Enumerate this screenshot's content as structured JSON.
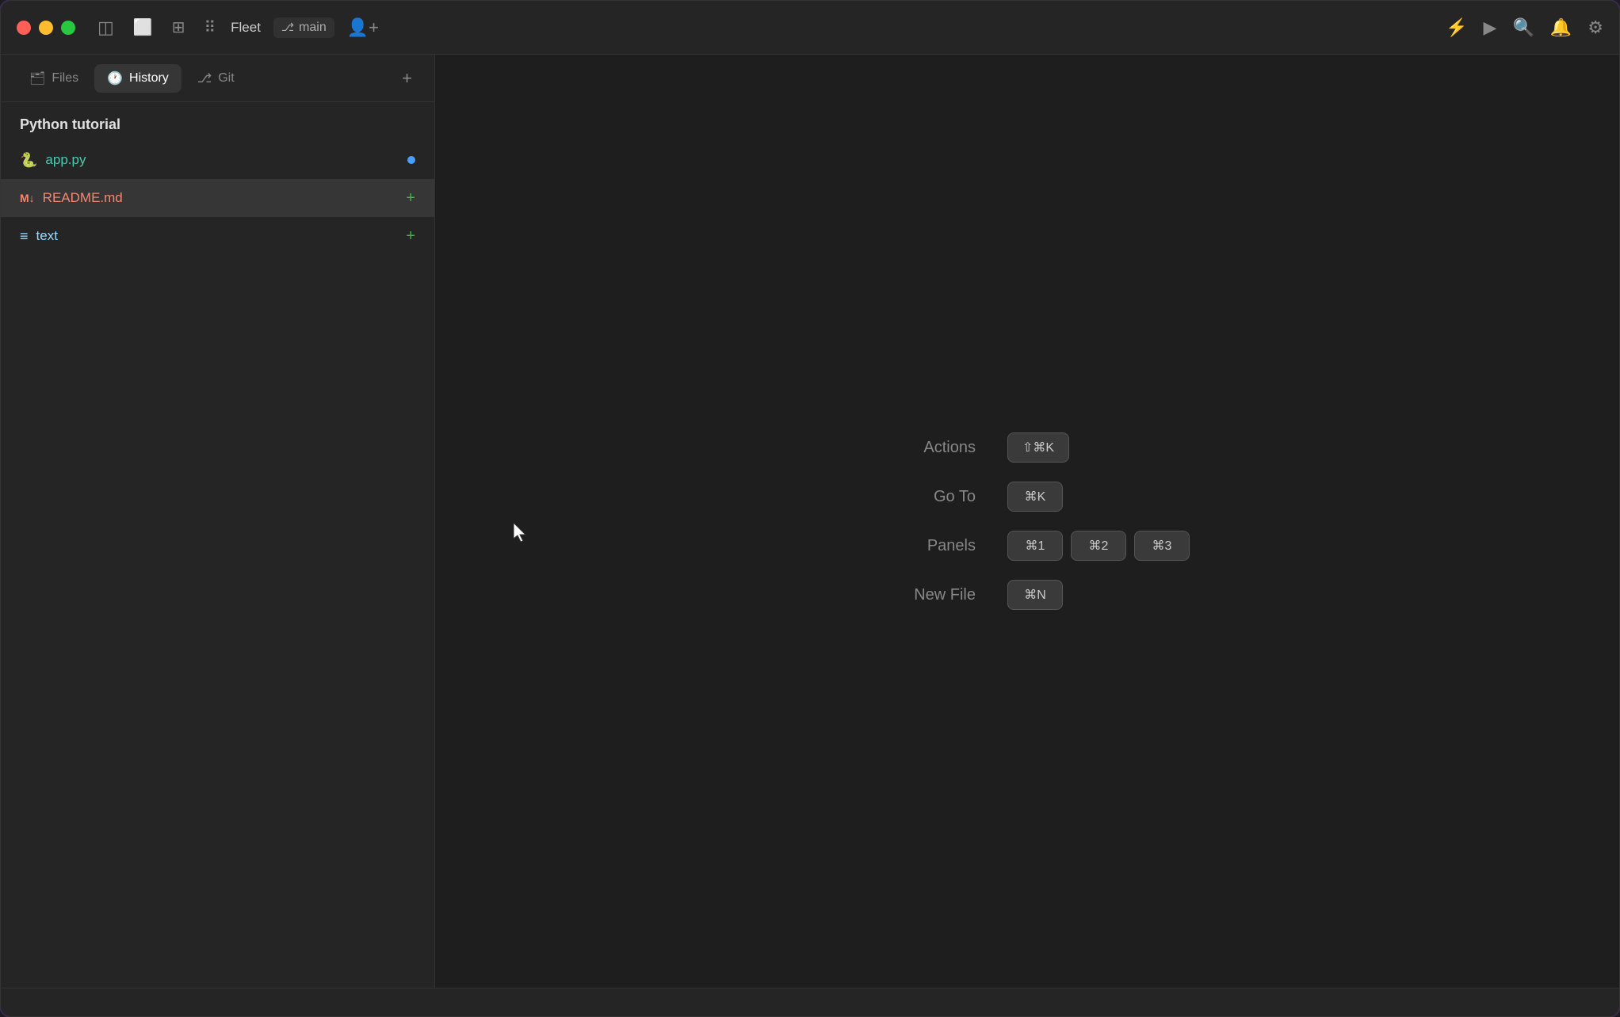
{
  "window": {
    "title": "Fleet"
  },
  "titlebar": {
    "traffic_lights": [
      "red",
      "yellow",
      "green"
    ],
    "sidebar_icon": "⊞",
    "layout_icon1": "▣",
    "layout_icon2": "⊡",
    "grid_icon": "⣿",
    "app_name": "Fleet",
    "branch_icon": "⎇",
    "branch_name": "main",
    "user_icon": "👤",
    "lightning_icon": "⚡",
    "play_icon": "▶",
    "search_icon": "🔍",
    "bell_icon": "🔔",
    "settings_icon": "⚙"
  },
  "sidebar": {
    "tabs": [
      {
        "id": "files",
        "label": "Files",
        "icon": "🗂",
        "active": false
      },
      {
        "id": "history",
        "label": "History",
        "icon": "🕐",
        "active": true
      },
      {
        "id": "git",
        "label": "Git",
        "icon": "⎇",
        "active": false
      }
    ],
    "add_label": "+",
    "project_title": "Python tutorial",
    "files": [
      {
        "name": "app.py",
        "icon": "🐍",
        "type": "py",
        "badge": "dot"
      },
      {
        "name": "README.md",
        "icon": "M↓",
        "type": "md",
        "badge": "plus",
        "selected": true
      },
      {
        "name": "text",
        "icon": "≡",
        "type": "text",
        "badge": "plus"
      }
    ]
  },
  "shortcuts": {
    "rows": [
      {
        "label": "Actions",
        "keys": [
          {
            "symbol": "⇧⌘K"
          }
        ]
      },
      {
        "label": "Go To",
        "keys": [
          {
            "symbol": "⌘K"
          }
        ]
      },
      {
        "label": "Panels",
        "keys": [
          {
            "symbol": "⌘1"
          },
          {
            "symbol": "⌘2"
          },
          {
            "symbol": "⌘3"
          }
        ]
      },
      {
        "label": "New File",
        "keys": [
          {
            "symbol": "⌘N"
          }
        ]
      }
    ]
  }
}
